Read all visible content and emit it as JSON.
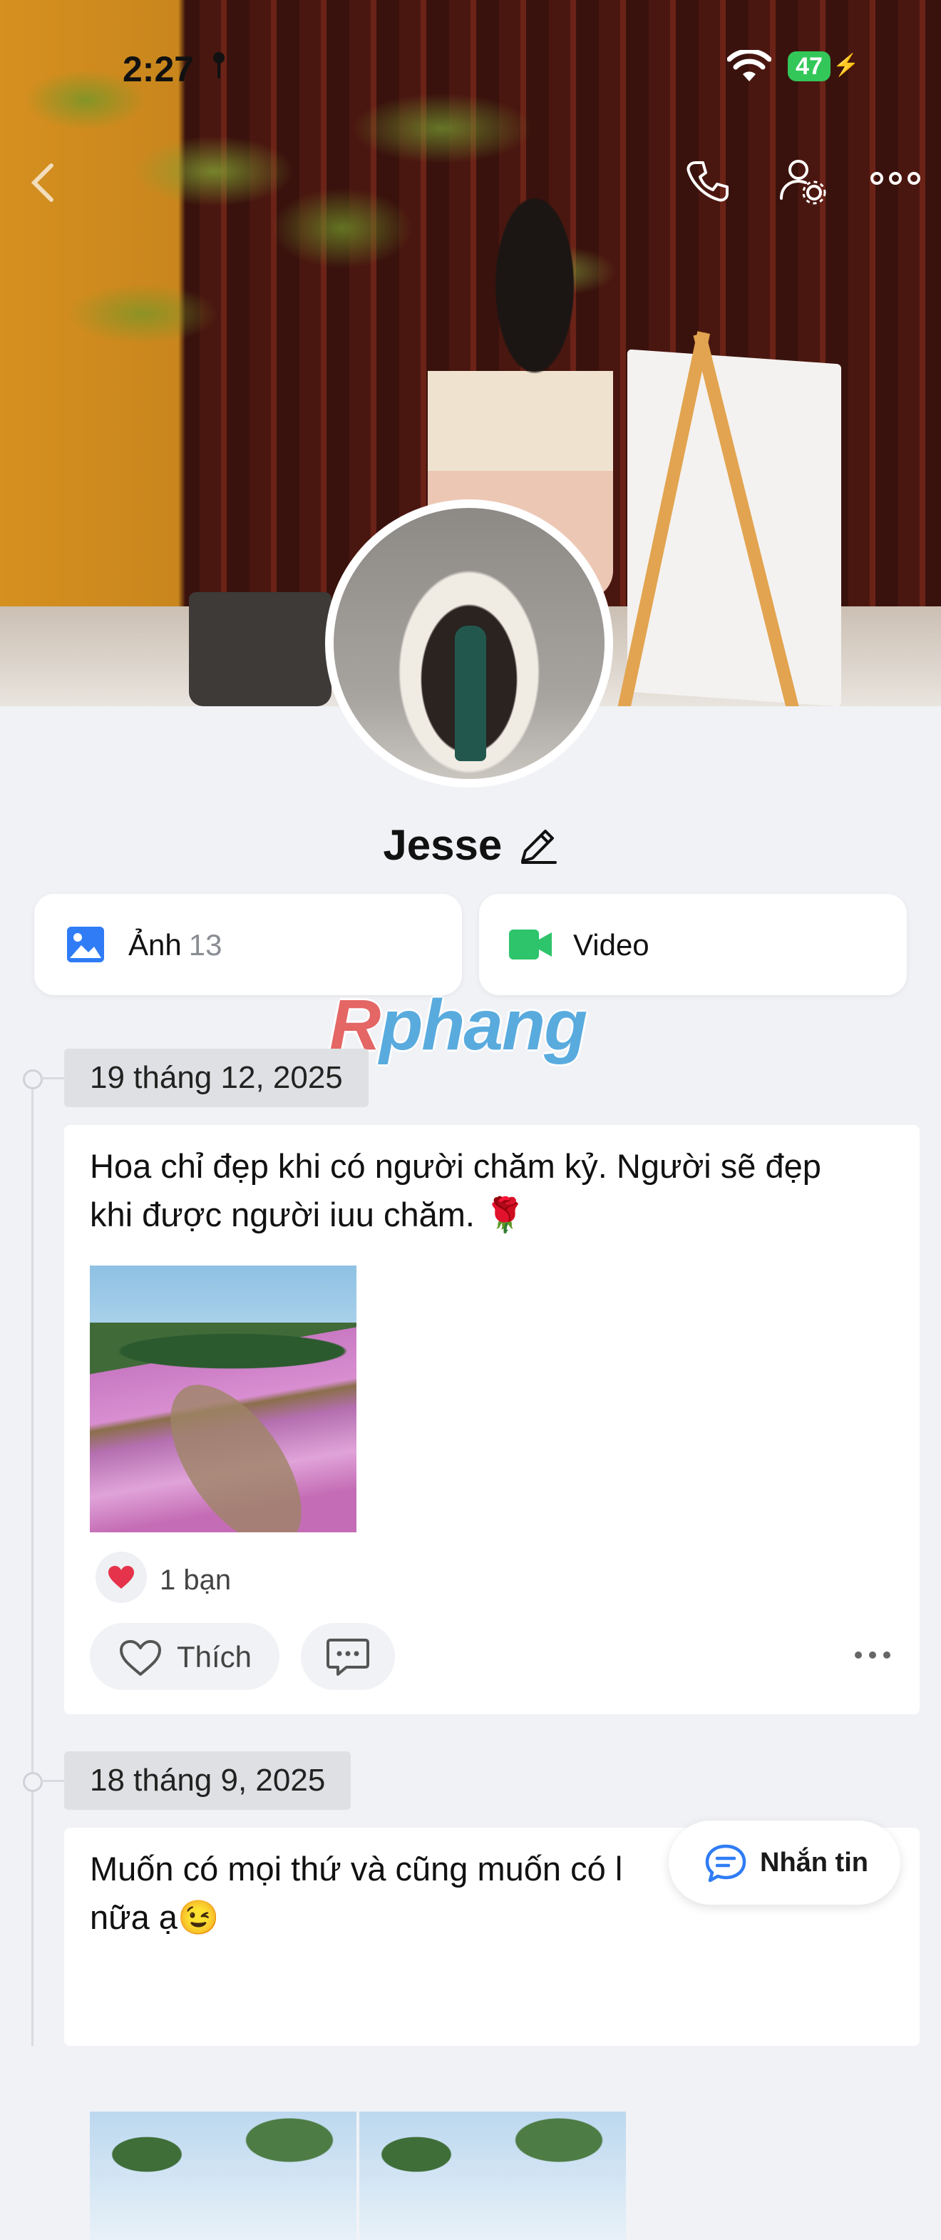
{
  "status_bar": {
    "time": "2:27",
    "battery": "47"
  },
  "profile": {
    "name": "Jesse"
  },
  "media": [
    {
      "label": "Ảnh",
      "count": "13"
    },
    {
      "label": "Video"
    }
  ],
  "watermark": {
    "r": "R",
    "rest": "phang"
  },
  "posts": [
    {
      "date": "19 tháng 12, 2025",
      "text_line1": "Hoa chỉ đẹp khi có người chăm kỷ. Người sẽ đẹp",
      "text_line2": "khi được người iuu chăm. 🌹",
      "reactions": "1 bạn",
      "like_label": "Thích"
    },
    {
      "date": "18 tháng 9, 2025",
      "text_line1": "Muốn có mọi thứ và cũng muốn có l",
      "text_line2": "nữa ạ😉"
    }
  ],
  "message_button": {
    "label": "Nhắn tin"
  },
  "colors": {
    "accent": "#2f7cf6",
    "video": "#2ec46b",
    "battery": "#33c759",
    "heart": "#e5334b"
  }
}
